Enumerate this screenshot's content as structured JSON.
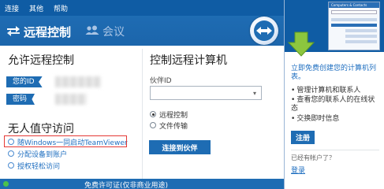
{
  "menu": {
    "items": [
      "连接",
      "其他",
      "帮助"
    ]
  },
  "header": {
    "tabs": [
      {
        "label": "远程控制",
        "icon": "remote-arrows-icon",
        "active": true
      },
      {
        "label": "会议",
        "icon": "meeting-people-icon",
        "active": false
      }
    ],
    "logo_icon": "teamviewer-logo-icon"
  },
  "allow_remote": {
    "title": "允许远程控制",
    "id_tag": "您的ID",
    "password_tag": "密码"
  },
  "unattended": {
    "title": "无人值守访问",
    "options": [
      "随Windows一同启动TeamViewer",
      "分配设备到账户",
      "授权轻松访问"
    ]
  },
  "control_remote": {
    "title": "控制远程计算机",
    "partner_id_label": "伙伴ID",
    "partner_id_value": "",
    "modes": [
      {
        "label": "远程控制",
        "checked": true
      },
      {
        "label": "文件传输",
        "checked": false
      }
    ],
    "connect_button": "连接到伙伴"
  },
  "footer": {
    "license_text": "免费许可证(仅非商业用途)",
    "status_color": "#4cc24c"
  },
  "side_panel": {
    "mini_window_title": "Computers & Contacts",
    "intro": "立即免费创建您的计算机列表。",
    "features": [
      "管理计算机和联系人",
      "查看您的联系人的在线状态",
      "交换即时信息"
    ],
    "signup_button": "注册",
    "has_account": "已经有帐户了？",
    "login_link": "登录"
  },
  "colors": {
    "brand_blue": "#1e6cb3",
    "menubar_blue": "#0f5ca4",
    "highlight_red": "#e53935",
    "link_blue": "#1f6fc0"
  }
}
